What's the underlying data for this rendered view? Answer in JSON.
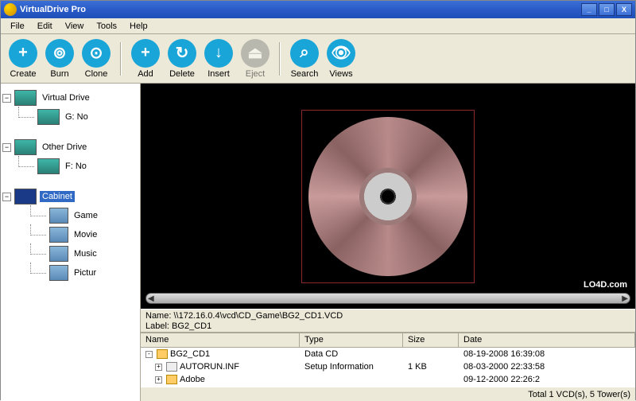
{
  "title": "VirtualDrive Pro",
  "menu": {
    "file": "File",
    "edit": "Edit",
    "view": "View",
    "tools": "Tools",
    "help": "Help"
  },
  "toolbar": {
    "create": "Create",
    "burn": "Burn",
    "clone": "Clone",
    "add": "Add",
    "delete": "Delete",
    "insert": "Insert",
    "eject": "Eject",
    "search": "Search",
    "views": "Views"
  },
  "tree": {
    "virtual_drive": "Virtual Drive",
    "g_drive": "G: No",
    "other_drive": "Other Drive",
    "f_drive": "F: No",
    "cabinet": "Cabinet",
    "game": "Game",
    "movie": "Movie",
    "music": "Music",
    "pictur": "Pictur"
  },
  "info": {
    "name_label": "Name:",
    "name_value": "\\\\172.16.0.4\\vcd\\CD_Game\\BG2_CD1.VCD",
    "label_label": "Label:",
    "label_value": "BG2_CD1"
  },
  "columns": {
    "name": "Name",
    "type": "Type",
    "size": "Size",
    "date": "Date"
  },
  "files": [
    {
      "name": "BG2_CD1",
      "type": "Data CD",
      "size": "",
      "date": "08-19-2008 16:39:08",
      "icon": "folder",
      "expand": "-"
    },
    {
      "name": "AUTORUN.INF",
      "type": "Setup Information",
      "size": "1 KB",
      "date": "08-03-2000 22:33:58",
      "icon": "file",
      "expand": "+"
    },
    {
      "name": "Adobe",
      "type": "",
      "size": "",
      "date": "09-12-2000 22:26:2",
      "icon": "folder",
      "expand": "+"
    }
  ],
  "status": "Total 1 VCD(s), 5 Tower(s)",
  "watermark": "LO4D.com",
  "winbtns": {
    "min": "_",
    "max": "□",
    "close": "X"
  },
  "icons": {
    "create": "+",
    "burn": "⊚",
    "clone": "⊙",
    "add": "+",
    "delete": "↻",
    "insert": "↓",
    "eject": "⏏",
    "search": "⌕",
    "views": "👁",
    "minus": "−",
    "plus": "+"
  }
}
